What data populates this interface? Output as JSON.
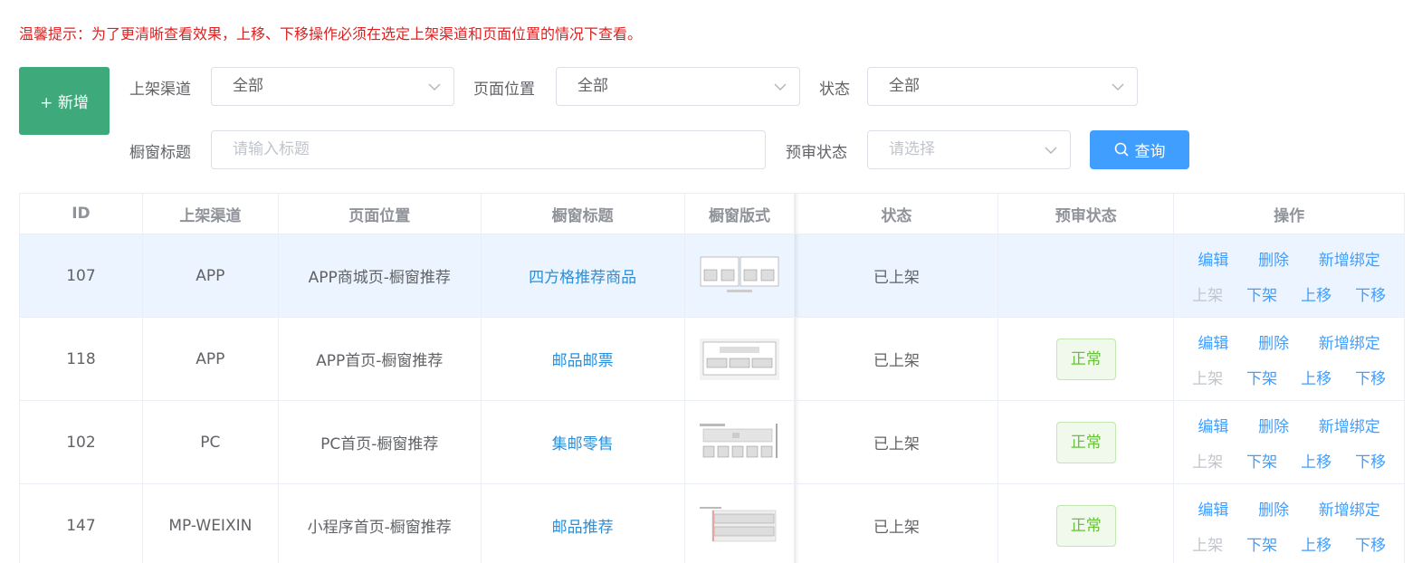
{
  "tip": "温馨提示：为了更清晰查看效果，上移、下移操作必须在选定上架渠道和页面位置的情况下查看。",
  "add_button": "+ 新增",
  "filters": {
    "channel": {
      "label": "上架渠道",
      "value": "全部"
    },
    "position": {
      "label": "页面位置",
      "value": "全部"
    },
    "status": {
      "label": "状态",
      "value": "全部"
    },
    "title": {
      "label": "橱窗标题",
      "placeholder": "请输入标题"
    },
    "review": {
      "label": "预审状态",
      "placeholder": "请选择"
    },
    "search_label": "查询"
  },
  "table": {
    "headers": [
      "ID",
      "上架渠道",
      "页面位置",
      "橱窗标题",
      "橱窗版式",
      "状态",
      "预审状态",
      "操作"
    ],
    "ops": {
      "edit": "编辑",
      "delete": "删除",
      "bind": "新增绑定",
      "up_shelf": "上架",
      "down_shelf": "下架",
      "move_up": "上移",
      "move_down": "下移"
    },
    "rows": [
      {
        "id": "107",
        "channel": "APP",
        "position": "APP商城页-橱窗推荐",
        "title": "四方格推荐商品",
        "status": "已上架",
        "review": ""
      },
      {
        "id": "118",
        "channel": "APP",
        "position": "APP首页-橱窗推荐",
        "title": "邮品邮票",
        "status": "已上架",
        "review": "正常"
      },
      {
        "id": "102",
        "channel": "PC",
        "position": "PC首页-橱窗推荐",
        "title": "集邮零售",
        "status": "已上架",
        "review": "正常"
      },
      {
        "id": "147",
        "channel": "MP-WEIXIN",
        "position": "小程序首页-橱窗推荐",
        "title": "邮品推荐",
        "status": "已上架",
        "review": "正常"
      }
    ]
  },
  "colors": {
    "primary": "#409eff",
    "add": "#3ea97a",
    "tip": "#e02020",
    "highlight_row": "#ecf5ff",
    "success": "#67c23a"
  }
}
